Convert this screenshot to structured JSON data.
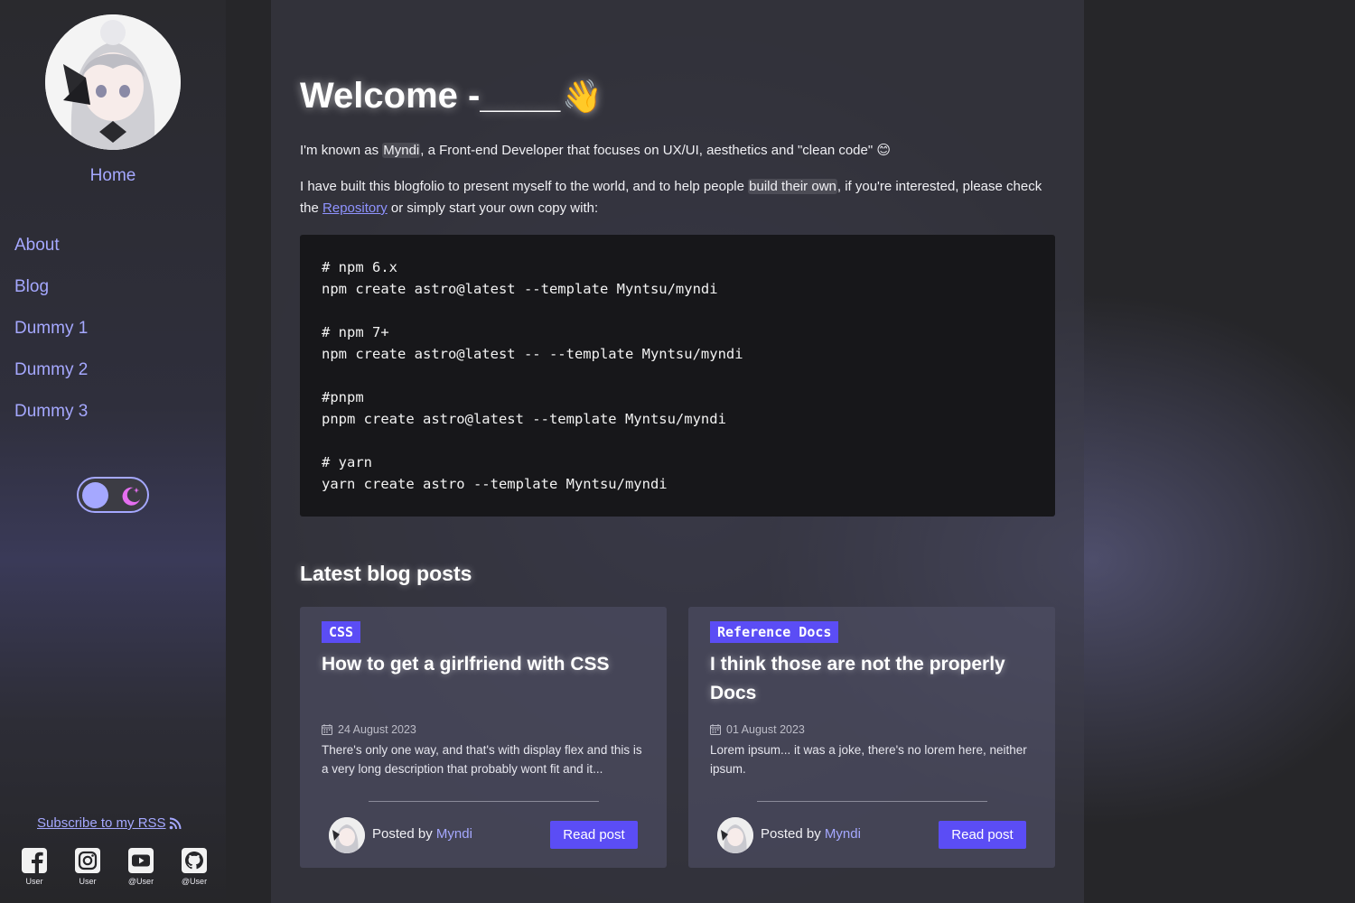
{
  "sidebar": {
    "home": "Home",
    "nav": [
      "About",
      "Blog",
      "Dummy 1",
      "Dummy 2",
      "Dummy 3"
    ],
    "rss": "Subscribe to my RSS",
    "socials": [
      {
        "icon": "facebook-icon",
        "label": "User"
      },
      {
        "icon": "instagram-icon",
        "label": "User"
      },
      {
        "icon": "youtube-icon",
        "label": "@User"
      },
      {
        "icon": "github-icon",
        "label": "@User"
      }
    ]
  },
  "main": {
    "welcome": "Welcome -____",
    "wave": "👋",
    "intro1": {
      "pre": "I'm known as ",
      "name": "Myndi",
      "post": ", a Front-end Developer that focuses on UX/UI, aesthetics and \"clean code\" ",
      "emoji": "😊"
    },
    "intro2": {
      "pre": "I have built this blogfolio to present myself to the world, and to help people ",
      "highlight": "build their own",
      "mid": ", if you're interested, please check the ",
      "link": "Repository",
      "post": " or simply start your own copy with:"
    },
    "code": "# npm 6.x\nnpm create astro@latest --template Myntsu/myndi\n\n# npm 7+\nnpm create astro@latest -- --template Myntsu/myndi\n\n#pnpm\npnpm create astro@latest --template Myntsu/myndi\n\n# yarn\nyarn create astro --template Myntsu/myndi",
    "latest_title": "Latest blog posts",
    "posts": [
      {
        "tag": "CSS",
        "title": "How to get a girlfriend with CSS",
        "date": "24 August 2023",
        "desc": "There's only one way, and that's with display flex and this is a very long description that probably wont fit and it...",
        "posted_by": "Posted by ",
        "author": "Myndi",
        "button": "Read post"
      },
      {
        "tag": "Reference Docs",
        "title": "I think those are not the properly Docs",
        "date": "01 August 2023",
        "desc": "Lorem ipsum... it was a joke, there's no lorem here, neither ipsum.",
        "posted_by": "Posted by ",
        "author": "Myndi",
        "button": "Read post"
      }
    ]
  },
  "colors": {
    "accent": "#a5a8ff",
    "button": "#5b4df5",
    "background": "#262629"
  }
}
